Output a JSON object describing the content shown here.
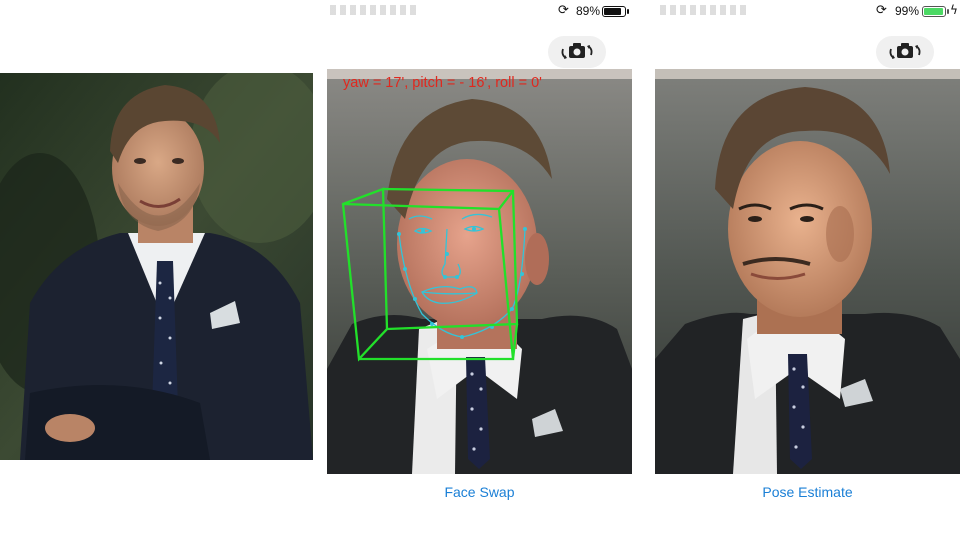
{
  "screen_mid": {
    "battery_text": "89%",
    "battery_level": 0.89,
    "orientation_lock_glyph": "⟳",
    "pose_text": "yaw = 17', pitch = - 16', roll = 0'",
    "tab_label": "Face Swap"
  },
  "screen_right": {
    "battery_text": "99%",
    "battery_level": 0.99,
    "orientation_lock_glyph": "⟳",
    "charging_glyph": "ϟ",
    "tab_label": "Pose Estimate"
  },
  "icons": {
    "camera_switch": "camera-switch-icon",
    "orientation_lock": "orientation-lock-icon",
    "battery": "battery-icon",
    "charging": "charging-bolt-icon"
  },
  "colors": {
    "tab_link": "#1a7fd6",
    "pose_text": "#e0281e",
    "landmarks": "#33c4d8",
    "pose_box": "#22e02a",
    "battery_charging": "#4cd964"
  }
}
